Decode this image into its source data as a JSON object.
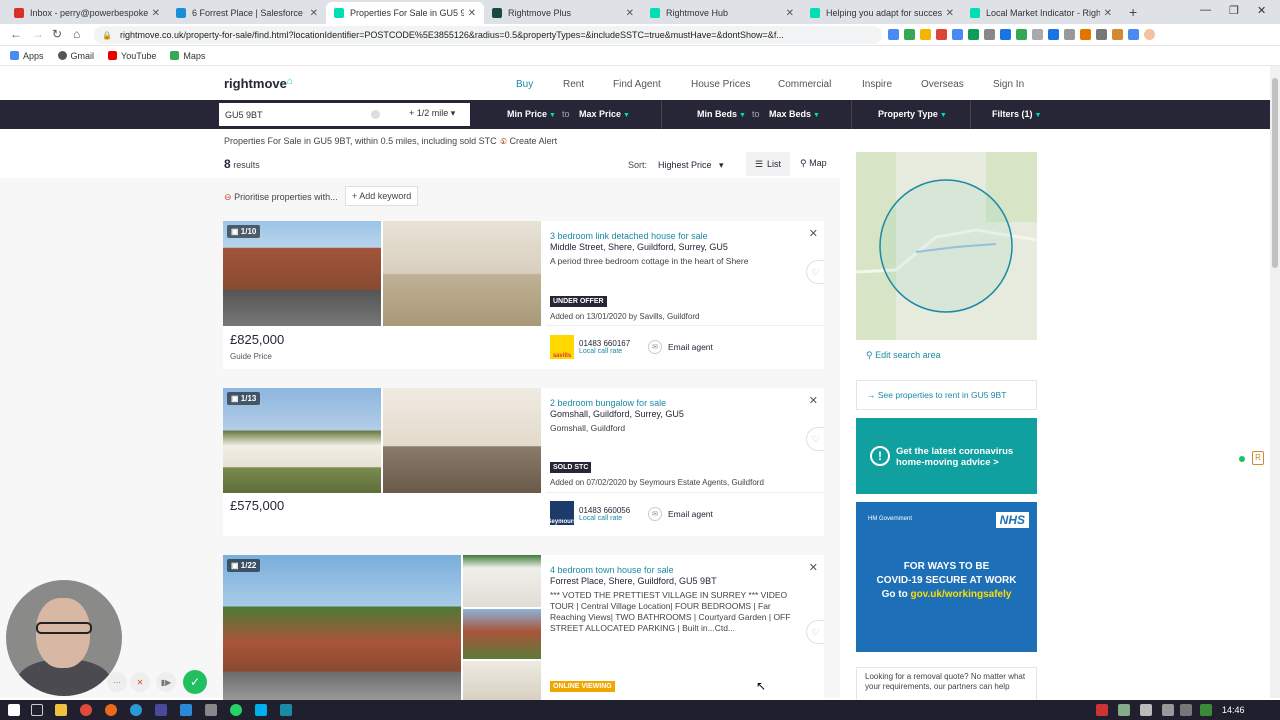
{
  "browser": {
    "tabs": [
      {
        "title": "Inbox - perry@powerbespoke.co",
        "color": "#d93025"
      },
      {
        "title": "6 Forrest Place | Salesforce",
        "color": "#1a8fd6"
      },
      {
        "title": "Properties For Sale in GU5 9",
        "color": "#00deb6"
      },
      {
        "title": "Rightmove Plus",
        "color": "#1b4a45"
      },
      {
        "title": "Rightmove Hub",
        "color": "#00deb6"
      },
      {
        "title": "Helping you adapt for success at",
        "color": "#00deb6"
      },
      {
        "title": "Local Market Indicator - Rightmo",
        "color": "#00deb6"
      }
    ],
    "url": "rightmove.co.uk/property-for-sale/find.html?locationIdentifier=POSTCODE%5E3855126&radius=0.5&propertyTypes=&includeSSTC=true&mustHave=&dontShow=&f...",
    "bookmarks": [
      "Apps",
      "Gmail",
      "YouTube",
      "Maps"
    ]
  },
  "site": {
    "logo": "rightmove",
    "nav": [
      "Buy",
      "Rent",
      "Find Agent",
      "House Prices",
      "Commercial",
      "Inspire",
      "Overseas",
      "Sign In"
    ],
    "search": {
      "location": "GU5 9BT",
      "radius": "+ 1/2 mile",
      "min_price": "Min Price",
      "to": "to",
      "max_price": "Max Price",
      "min_beds": "Min Beds",
      "max_beds": "Max Beds",
      "property_type": "Property Type",
      "filters": "Filters (1)"
    },
    "breadcrumb": "Properties For Sale in GU5 9BT, within 0.5 miles, including sold STC",
    "create_alert": "Create Alert",
    "results_count": "8",
    "results_label": "results",
    "sort_label": "Sort:",
    "sort_value": "Highest Price",
    "list_label": "List",
    "map_label": "Map",
    "prioritise": "Prioritise properties with...",
    "add_keyword": "+ Add keyword"
  },
  "listings": [
    {
      "photo_count": "1/10",
      "title": "3 bedroom link detached house for sale",
      "address": "Middle Street, Shere, Guildford, Surrey, GU5",
      "description": "A period three bedroom cottage in the heart of Shere",
      "status": "UNDER OFFER",
      "added": "Added on 13/01/2020 by Savills, Guildford",
      "price": "£825,000",
      "qualifier": "Guide Price",
      "agent": "savills",
      "phone": "01483 660167",
      "phone_note": "Local call rate",
      "email": "Email agent"
    },
    {
      "photo_count": "1/13",
      "title": "2 bedroom bungalow for sale",
      "address": "Gomshall, Guildford, Surrey, GU5",
      "description": "Gomshall, Guildford",
      "status": "SOLD STC",
      "added": "Added on 07/02/2020 by Seymours Estate Agents, Guildford",
      "price": "£575,000",
      "qualifier": "",
      "agent": "Seymours",
      "phone": "01483 660056",
      "phone_note": "Local call rate",
      "email": "Email agent"
    },
    {
      "photo_count": "1/22",
      "title": "4 bedroom town house for sale",
      "address": "Forrest Place, Shere, Guildford, GU5 9BT",
      "description": "*** VOTED THE PRETTIEST VILLAGE IN SURREY *** VIDEO TOUR | Central Village Location| FOUR BEDROOMS | Far Reaching Views| TWO BATHROOMS | Courtyard Garden | OFF STREET ALLOCATED PARKING | Built in...Ctd...",
      "status": "ONLINE VIEWING"
    }
  ],
  "sidebar": {
    "edit_search": "Edit search area",
    "rent_link": "See properties to rent in GU5 9BT",
    "covid_line1": "Get the latest coronavirus",
    "covid_line2": "home-moving advice >",
    "nhs_gov": "HM Government",
    "nhs_logo": "NHS",
    "nhs_line1": "FOR WAYS TO BE",
    "nhs_line2": "COVID-19 SECURE AT WORK",
    "nhs_line3": "Go to",
    "nhs_url": "gov.uk/workingsafely",
    "removal": "Looking for a removal quote? No matter what your requirements, our partners can help"
  },
  "taskbar": {
    "clock": "14:46"
  }
}
